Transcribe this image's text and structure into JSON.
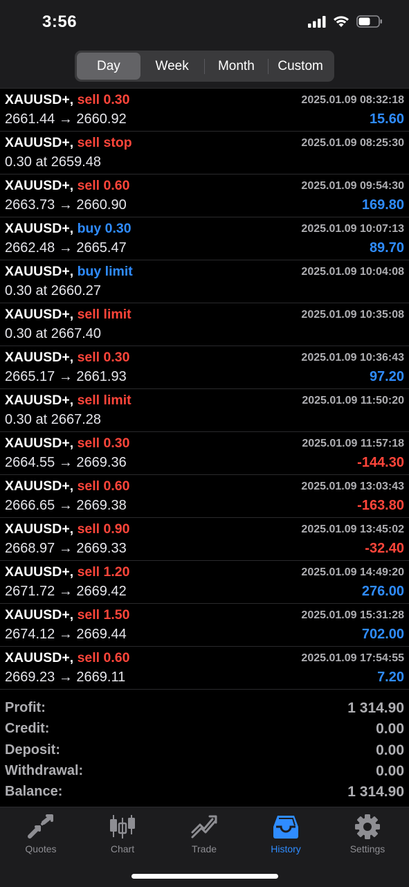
{
  "status": {
    "time": "3:56"
  },
  "period_tabs": [
    {
      "label": "Day",
      "active": true
    },
    {
      "label": "Week",
      "active": false
    },
    {
      "label": "Month",
      "active": false
    },
    {
      "label": "Custom",
      "active": false
    }
  ],
  "deals": [
    {
      "symbol": "XAUUSD+,",
      "action": "sell 0.30",
      "side": "sell",
      "detail": "2661.44 → 2660.92",
      "time": "2025.01.09 08:32:18",
      "profit": "15.60",
      "profit_sign": "pos"
    },
    {
      "symbol": "XAUUSD+,",
      "action": "sell stop",
      "side": "sell",
      "detail": "0.30 at 2659.48",
      "time": "2025.01.09 08:25:30",
      "profit": "",
      "profit_sign": "pos"
    },
    {
      "symbol": "XAUUSD+,",
      "action": "sell 0.60",
      "side": "sell",
      "detail": "2663.73 → 2660.90",
      "time": "2025.01.09 09:54:30",
      "profit": "169.80",
      "profit_sign": "pos"
    },
    {
      "symbol": "XAUUSD+,",
      "action": "buy 0.30",
      "side": "buy",
      "detail": "2662.48 → 2665.47",
      "time": "2025.01.09 10:07:13",
      "profit": "89.70",
      "profit_sign": "pos"
    },
    {
      "symbol": "XAUUSD+,",
      "action": "buy limit",
      "side": "buy",
      "detail": "0.30 at 2660.27",
      "time": "2025.01.09 10:04:08",
      "profit": "",
      "profit_sign": "pos"
    },
    {
      "symbol": "XAUUSD+,",
      "action": "sell limit",
      "side": "sell",
      "detail": "0.30 at 2667.40",
      "time": "2025.01.09 10:35:08",
      "profit": "",
      "profit_sign": "pos"
    },
    {
      "symbol": "XAUUSD+,",
      "action": "sell 0.30",
      "side": "sell",
      "detail": "2665.17 → 2661.93",
      "time": "2025.01.09 10:36:43",
      "profit": "97.20",
      "profit_sign": "pos"
    },
    {
      "symbol": "XAUUSD+,",
      "action": "sell limit",
      "side": "sell",
      "detail": "0.30 at 2667.28",
      "time": "2025.01.09 11:50:20",
      "profit": "",
      "profit_sign": "pos"
    },
    {
      "symbol": "XAUUSD+,",
      "action": "sell 0.30",
      "side": "sell",
      "detail": "2664.55 → 2669.36",
      "time": "2025.01.09 11:57:18",
      "profit": "-144.30",
      "profit_sign": "neg"
    },
    {
      "symbol": "XAUUSD+,",
      "action": "sell 0.60",
      "side": "sell",
      "detail": "2666.65 → 2669.38",
      "time": "2025.01.09 13:03:43",
      "profit": "-163.80",
      "profit_sign": "neg"
    },
    {
      "symbol": "XAUUSD+,",
      "action": "sell 0.90",
      "side": "sell",
      "detail": "2668.97 → 2669.33",
      "time": "2025.01.09 13:45:02",
      "profit": "-32.40",
      "profit_sign": "neg"
    },
    {
      "symbol": "XAUUSD+,",
      "action": "sell 1.20",
      "side": "sell",
      "detail": "2671.72 → 2669.42",
      "time": "2025.01.09 14:49:20",
      "profit": "276.00",
      "profit_sign": "pos"
    },
    {
      "symbol": "XAUUSD+,",
      "action": "sell 1.50",
      "side": "sell",
      "detail": "2674.12 → 2669.44",
      "time": "2025.01.09 15:31:28",
      "profit": "702.00",
      "profit_sign": "pos"
    },
    {
      "symbol": "XAUUSD+,",
      "action": "sell 0.60",
      "side": "sell",
      "detail": "2669.23 → 2669.11",
      "time": "2025.01.09 17:54:55",
      "profit": "7.20",
      "profit_sign": "pos"
    }
  ],
  "summary": [
    {
      "label": "Profit:",
      "value": "1 314.90"
    },
    {
      "label": "Credit:",
      "value": "0.00"
    },
    {
      "label": "Deposit:",
      "value": "0.00"
    },
    {
      "label": "Withdrawal:",
      "value": "0.00"
    },
    {
      "label": "Balance:",
      "value": "1 314.90"
    }
  ],
  "tabbar": [
    {
      "label": "Quotes",
      "icon": "quotes-icon",
      "active": false
    },
    {
      "label": "Chart",
      "icon": "chart-icon",
      "active": false
    },
    {
      "label": "Trade",
      "icon": "trade-icon",
      "active": false
    },
    {
      "label": "History",
      "icon": "history-icon",
      "active": true
    },
    {
      "label": "Settings",
      "icon": "settings-icon",
      "active": false
    }
  ],
  "colors": {
    "sell": "#ff453a",
    "buy": "#2f8cff",
    "active_tab": "#2f8cff",
    "inactive_tab": "#8e8e93"
  }
}
